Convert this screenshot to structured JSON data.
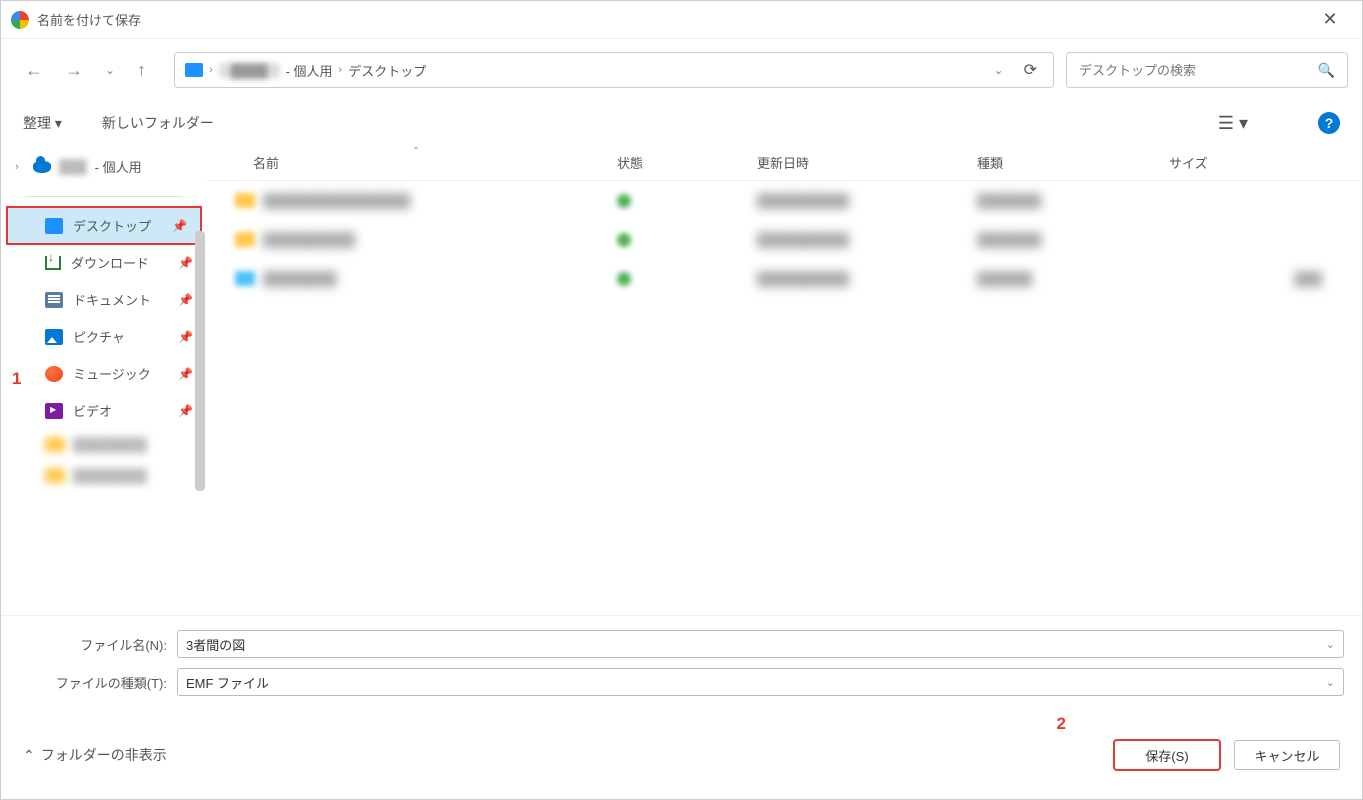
{
  "titlebar": {
    "title": "名前を付けて保存"
  },
  "breadcrumb": {
    "user_suffix": " - 個人用",
    "current": "デスクトップ"
  },
  "search": {
    "placeholder": "デスクトップの検索"
  },
  "toolbar": {
    "organize": "整理",
    "new_folder": "新しいフォルダー"
  },
  "sidebar": {
    "tree_user_suffix": " - 個人用",
    "quick": [
      {
        "label": "デスクトップ",
        "selected": true
      },
      {
        "label": "ダウンロード"
      },
      {
        "label": "ドキュメント"
      },
      {
        "label": "ピクチャ"
      },
      {
        "label": "ミュージック"
      },
      {
        "label": "ビデオ"
      }
    ]
  },
  "columns": {
    "name": "名前",
    "state": "状態",
    "date": "更新日時",
    "type": "種類",
    "size": "サイズ"
  },
  "form": {
    "filename_label": "ファイル名(N):",
    "filename_value": "3者間の図",
    "filetype_label": "ファイルの種類(T):",
    "filetype_value": "EMF ファイル"
  },
  "footer": {
    "hide_folders": "フォルダーの非表示",
    "save": "保存(S)",
    "cancel": "キャンセル"
  },
  "callouts": {
    "one": "1",
    "two": "2"
  }
}
